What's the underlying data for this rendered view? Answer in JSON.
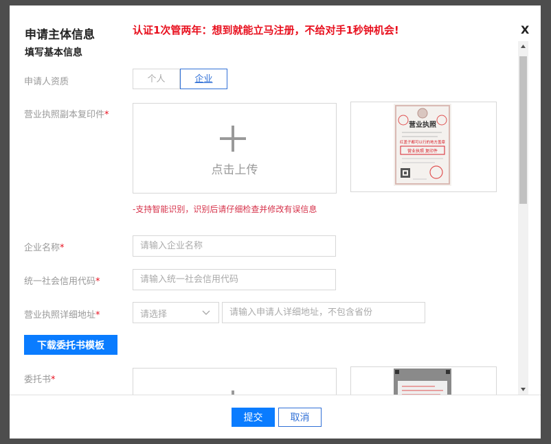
{
  "dialog": {
    "title": "申请主体信息",
    "promo": "认证1次管两年：想到就能立马注册，不给对手1秒钟机会!",
    "close_label": "X"
  },
  "form": {
    "section_title": "填写基本信息",
    "qualification": {
      "label": "申请人资质",
      "options": [
        "个人",
        "企业"
      ],
      "selected": "企业"
    },
    "license": {
      "label": "营业执照副本复印件",
      "required_mark": "*",
      "upload_text": "点击上传",
      "hint": "-支持智能识别，识别后请仔细检查并修改有误信息",
      "sample": {
        "title": "营业执照",
        "stamp_text": "红盖子都可以行的地方盖章",
        "red_text": "营业执照 复印件"
      }
    },
    "company_name": {
      "label": "企业名称",
      "required_mark": "*",
      "placeholder": "请输入企业名称",
      "value": ""
    },
    "credit_code": {
      "label": "统一社会信用代码",
      "required_mark": "*",
      "placeholder": "请输入统一社会信用代码",
      "value": ""
    },
    "address": {
      "label": "营业执照详细地址",
      "required_mark": "*",
      "select_placeholder": "请选择",
      "placeholder": "请输入申请人详细地址，不包含省份",
      "value": ""
    },
    "download_button": "下载委托书模板",
    "authorization": {
      "label": "委托书",
      "required_mark": "*"
    }
  },
  "footer": {
    "submit_label": "提交",
    "cancel_label": "取消"
  },
  "colors": {
    "accent": "#0a7cff",
    "outline_blue": "#2f6fd6",
    "alert_red": "#e8101e",
    "backdrop": "#4d4d4d"
  }
}
